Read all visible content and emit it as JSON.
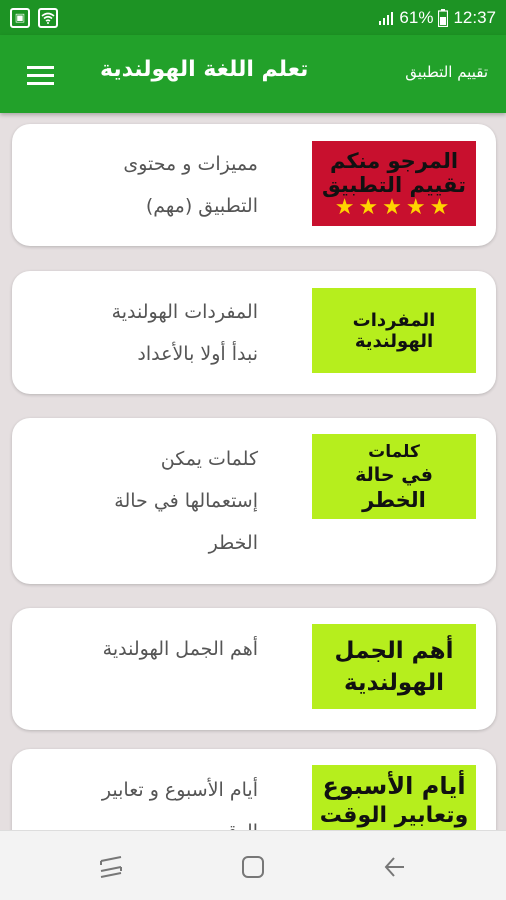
{
  "status_bar": {
    "battery": "61%",
    "time": "12:37"
  },
  "app_bar": {
    "title": "تعلم اللغة الهولندية",
    "rate_label": "تقييم التطبيق"
  },
  "items": [
    {
      "text_lines": [
        "مميزات و محتوى",
        "التطبيق (مهم)"
      ],
      "thumb_lines": [
        "المرجو منكم",
        "تقييم التطبيق"
      ],
      "thumb_stars": "★★★★★"
    },
    {
      "text_lines": [
        "المفردات الهولندية",
        "نبدأ أولا بالأعداد"
      ],
      "thumb_lines": [
        "المفردات الهولندية"
      ]
    },
    {
      "text_lines": [
        "كلمات يمكن",
        "إستعمالها في حالة",
        "الخطر"
      ],
      "thumb_lines": [
        "كلمات",
        "في حالة",
        "الخطر"
      ]
    },
    {
      "text_lines": [
        "أهم الجمل الهولندية"
      ],
      "thumb_lines": [
        "أهم الجمل",
        "الهولندية"
      ]
    },
    {
      "text_lines": [
        "أيام الأسبوع و تعابير",
        "الوقت"
      ],
      "thumb_lines": [
        "أيام الأسبوع",
        "وتعابير الوقت"
      ]
    }
  ],
  "colors": {
    "status_bar": "#1d9324",
    "app_bar": "#22a12a",
    "background": "#e5dfe0",
    "thumb_red": "#c8102e",
    "thumb_green": "#b6ee1d",
    "star": "#ffd400"
  }
}
